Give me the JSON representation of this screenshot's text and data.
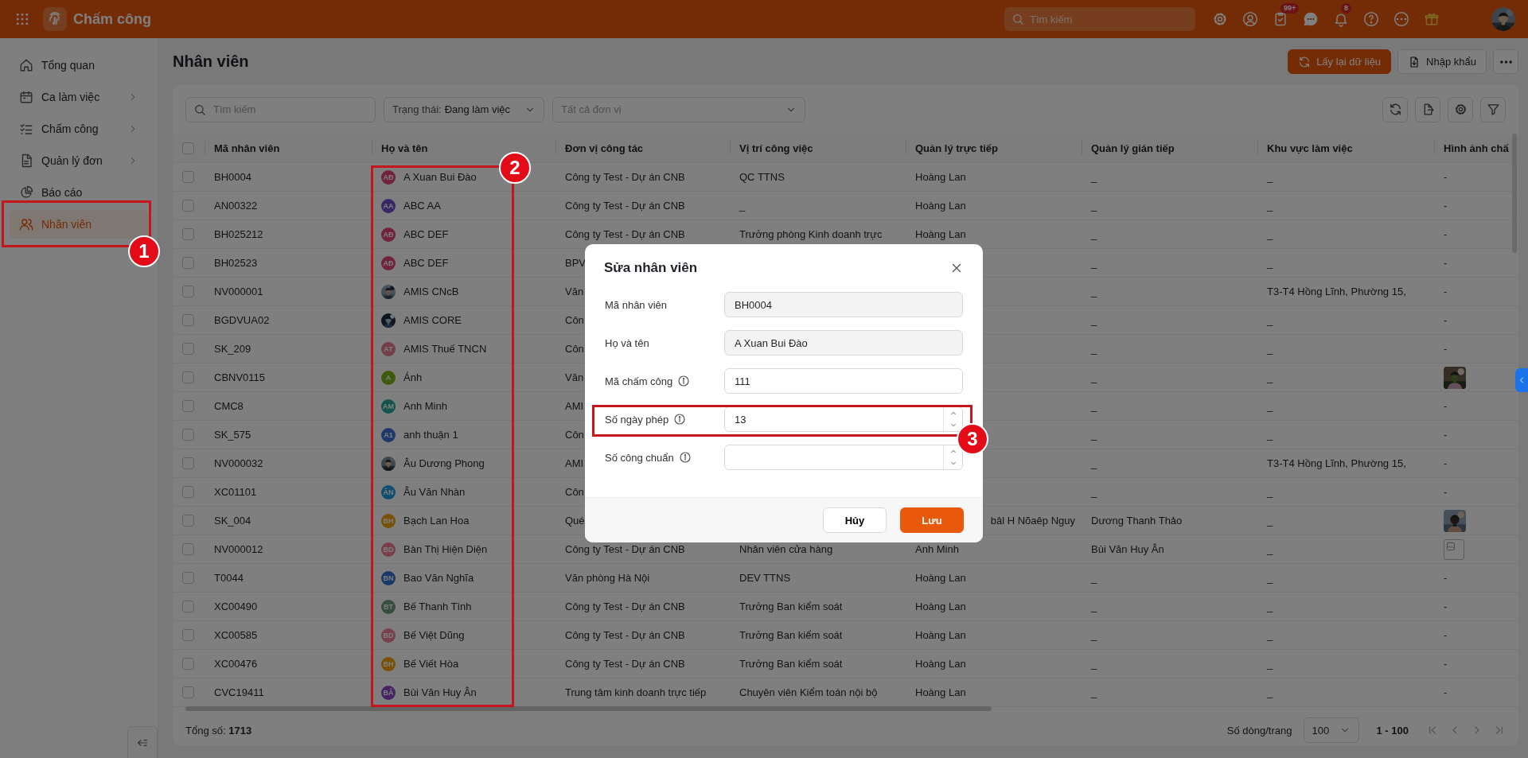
{
  "topbar": {
    "app_name": "Chấm công",
    "search": {
      "placeholder": "Tìm kiếm"
    },
    "icons": [
      {
        "kind": "settings"
      },
      {
        "kind": "contacts"
      },
      {
        "kind": "tasks",
        "badge": "99+"
      },
      {
        "kind": "chat"
      },
      {
        "kind": "bell",
        "badge": "8"
      },
      {
        "kind": "help"
      },
      {
        "kind": "more"
      },
      {
        "kind": "gift"
      },
      {
        "kind": "avatar"
      }
    ]
  },
  "sidebar": {
    "items": [
      {
        "label": "Tổng quan",
        "kind": "home",
        "expandable": false,
        "selected": false
      },
      {
        "label": "Ca làm việc",
        "kind": "calendar",
        "expandable": true,
        "selected": false
      },
      {
        "label": "Chấm công",
        "kind": "checklist",
        "expandable": true,
        "selected": false
      },
      {
        "label": "Quản lý đơn",
        "kind": "document",
        "expandable": true,
        "selected": false
      },
      {
        "label": "Báo cáo",
        "kind": "pie",
        "expandable": false,
        "selected": false
      },
      {
        "label": "Nhân viên",
        "kind": "users",
        "expandable": false,
        "selected": true
      }
    ]
  },
  "page": {
    "title": "Nhân viên",
    "actions": [
      {
        "kind": "refresh",
        "label": "Lấy lại dữ liệu"
      },
      {
        "kind": "import",
        "label": "Nhập khẩu"
      },
      {
        "kind": "more"
      }
    ]
  },
  "filters": {
    "search": {
      "placeholder": "Tìm kiếm"
    },
    "status": {
      "label": "Trạng thái:",
      "value": "Đang làm việc"
    },
    "unit": {
      "placeholder": "Tất cả đơn vị"
    },
    "tools": [
      {
        "kind": "refresh"
      },
      {
        "kind": "export"
      },
      {
        "kind": "settings"
      },
      {
        "kind": "filter"
      }
    ]
  },
  "table": {
    "select_all": false,
    "columns": [
      "Mã nhân viên",
      "Họ và tên",
      "Đơn vị công tác",
      "Vị trí công việc",
      "Quản lý trực tiếp",
      "Quản lý gián tiếp",
      "Khu vực làm việc",
      "Hình ảnh chấ"
    ],
    "rows": [
      {
        "checked": false,
        "code": "BH0004",
        "name": "A Xuan Bui Đào",
        "avatar": {
          "kind": "initials",
          "initials": "AĐ",
          "color": "#70223e"
        },
        "unit": "Công ty Test - Dự án CNB",
        "position": "QC TTNS",
        "direct_manager": "Hoàng Lan",
        "indirect_manager": "_",
        "area": "_",
        "photo": {
          "kind": "text",
          "text": "-"
        }
      },
      {
        "checked": false,
        "code": "AN00322",
        "name": "ABC AA",
        "avatar": {
          "kind": "initials",
          "initials": "AA",
          "color": "#382864"
        },
        "unit": "Công ty Test - Dự án CNB",
        "position": "_",
        "direct_manager": "Hoàng Lan",
        "indirect_manager": "_",
        "area": "_",
        "photo": {
          "kind": "text",
          "text": "-"
        }
      },
      {
        "checked": false,
        "code": "BH025212",
        "name": "ABC DEF",
        "avatar": {
          "kind": "initials",
          "initials": "AĐ",
          "color": "#70223e"
        },
        "unit": "Công ty Test - Dự án CNB",
        "position": "Trưởng phòng Kinh doanh trực",
        "direct_manager": "Hoàng Lan",
        "indirect_manager": "_",
        "area": "_",
        "photo": {
          "kind": "text",
          "text": "-"
        }
      },
      {
        "checked": false,
        "code": "BH02523",
        "name": "ABC DEF",
        "avatar": {
          "kind": "initials",
          "initials": "AĐ",
          "color": "#70223e"
        },
        "unit": "BPV",
        "indirect_manager": "_",
        "area": "_",
        "photo": {
          "kind": "text",
          "text": "-"
        }
      },
      {
        "checked": false,
        "code": "NV000001",
        "name": "AMIS CNcB",
        "unit": "Văn",
        "indirect_manager": "_",
        "area": "T3-T4 Hồng Lĩnh, Phường 15,",
        "photo": {
          "kind": "text",
          "text": "-"
        }
      },
      {
        "checked": false,
        "code": "BGDVUA02",
        "name": "AMIS CORE",
        "unit": "Côn",
        "indirect_manager": "_",
        "area": "_",
        "photo": {
          "kind": "text",
          "text": "-"
        }
      },
      {
        "checked": false,
        "code": "SK_209",
        "name": "AMIS Thuế TNCN",
        "avatar": {
          "kind": "initials",
          "initials": "AT",
          "color": "#743d47"
        },
        "unit": "Côn",
        "indirect_manager": "_",
        "area": "_",
        "photo": {
          "kind": "text",
          "text": "-"
        }
      },
      {
        "checked": false,
        "code": "CBNV0115",
        "name": "Ánh",
        "avatar": {
          "kind": "initials",
          "initials": "A",
          "color": "#3e5a0c"
        },
        "unit": "Văn",
        "indirect_manager": "_",
        "area": "_"
      },
      {
        "checked": false,
        "code": "CMC8",
        "name": "Anh Minh",
        "avatar": {
          "kind": "initials",
          "initials": "AM",
          "color": "#13534d"
        },
        "unit": "AMI",
        "indirect_manager": "_",
        "area": "_",
        "photo": {
          "kind": "text",
          "text": "-"
        }
      },
      {
        "checked": false,
        "code": "SK_575",
        "name": "anh thuận 1",
        "avatar": {
          "kind": "initials",
          "initials": "A1",
          "color": "#1e3868"
        },
        "unit": "Côn",
        "indirect_manager": "_",
        "area": "_",
        "photo": {
          "kind": "text",
          "text": "-"
        }
      },
      {
        "checked": false,
        "code": "NV000032",
        "name": "Âu Dương Phong",
        "unit": "AMI",
        "indirect_manager": "_",
        "area": "T3-T4 Hồng Lĩnh, Phường 15,",
        "photo": {
          "kind": "text",
          "text": "-"
        }
      },
      {
        "checked": false,
        "code": "XC01101",
        "name": "Âu Văn Nhàn",
        "avatar": {
          "kind": "initials",
          "initials": "ÂN",
          "color": "#0f4e6c"
        },
        "unit": "Côn",
        "indirect_manager": "_",
        "area": "_",
        "photo": {
          "kind": "text",
          "text": "-"
        }
      },
      {
        "checked": false,
        "code": "SK_004",
        "name": "Bạch Lan Hoa",
        "avatar": {
          "kind": "initials",
          "initials": "BH",
          "color": "#785006"
        },
        "unit": "Qué",
        "direct_manager": "bâl H Nõaêp Nguy",
        "indirect_manager": "Dương Thanh Thảo",
        "area": "_"
      },
      {
        "checked": false,
        "code": "NV000012",
        "name": "Bàn Thị Hiện Diện",
        "avatar": {
          "kind": "initials",
          "initials": "BD",
          "color": "#783f4d"
        },
        "unit": "Công ty Test - Dự án CNB",
        "position": "Nhân viên cửa hàng",
        "direct_manager": "Anh Minh",
        "indirect_manager": "Bùi Văn Huy Ân",
        "area": "_",
        "photo": {
          "kind": "broken"
        }
      },
      {
        "checked": false,
        "code": "T0044",
        "name": "Bao Văn Nghĩa",
        "avatar": {
          "kind": "initials",
          "initials": "BN",
          "color": "#183868"
        },
        "unit": "Văn phòng Hà Nội",
        "position": "DEV TTNS",
        "direct_manager": "Hoàng Lan",
        "indirect_manager": "_",
        "area": "_",
        "photo": {
          "kind": "text",
          "text": "-"
        }
      },
      {
        "checked": false,
        "code": "XC00490",
        "name": "Bế Thanh Tình",
        "avatar": {
          "kind": "initials",
          "initials": "BT",
          "color": "#364d40"
        },
        "unit": "Công ty Test - Dự án CNB",
        "position": "Trưởng Ban kiểm soát",
        "direct_manager": "Hoàng Lan",
        "indirect_manager": "_",
        "area": "_",
        "photo": {
          "kind": "text",
          "text": "-"
        }
      },
      {
        "checked": false,
        "code": "XC00585",
        "name": "Bế Việt Dũng",
        "avatar": {
          "kind": "initials",
          "initials": "BD",
          "color": "#783f4d"
        },
        "unit": "Công ty Test - Dự án CNB",
        "position": "Trưởng Ban kiểm soát",
        "direct_manager": "Hoàng Lan",
        "indirect_manager": "_",
        "area": "_",
        "photo": {
          "kind": "text",
          "text": "-"
        }
      },
      {
        "checked": false,
        "code": "XC00476",
        "name": "Bế Viết Hòa",
        "avatar": {
          "kind": "initials",
          "initials": "BH",
          "color": "#785006"
        },
        "unit": "Công ty Test - Dự án CNB",
        "position": "Trưởng Ban kiểm soát",
        "direct_manager": "Hoàng Lan",
        "indirect_manager": "_",
        "area": "_",
        "photo": {
          "kind": "text",
          "text": "-"
        }
      },
      {
        "checked": false,
        "code": "CVC19411",
        "name": "Bùi Văn Huy Ân",
        "avatar": {
          "kind": "initials",
          "initials": "BÂ",
          "color": "#472264"
        },
        "unit": "Trung tâm kinh doanh trực tiếp",
        "position": "Chuyên viên Kiểm toán nội bộ",
        "direct_manager": "Hoàng Lan",
        "indirect_manager": "_",
        "area": "_",
        "photo": {
          "kind": "text",
          "text": "-"
        }
      }
    ]
  },
  "footer": {
    "total": "Tổng số: **1713**",
    "page_size_label": "Số dòng/trang",
    "page_size": "100",
    "range": "1 - 100"
  },
  "modal": {
    "title": "Sửa nhân viên",
    "fields": [
      {
        "label": "Mã nhân viên",
        "kind": "readonly",
        "info": false,
        "value": "BH0004"
      },
      {
        "label": "Họ và tên",
        "kind": "readonly",
        "info": false,
        "value": "A Xuan Bui Đào"
      },
      {
        "label": "Mã chấm công",
        "kind": "text",
        "info": true,
        "value": "111"
      },
      {
        "label": "Số ngày phép",
        "kind": "number",
        "info": true,
        "value": "13"
      },
      {
        "label": "Số công chuẩn",
        "kind": "number",
        "info": true
      }
    ],
    "buttons": [
      {
        "label": "Hủy",
        "kind": "secondary"
      },
      {
        "label": "Lưu",
        "kind": "primary"
      }
    ]
  },
  "annotations": [
    {
      "number": "1"
    },
    {
      "number": "2"
    },
    {
      "number": "3"
    }
  ]
}
